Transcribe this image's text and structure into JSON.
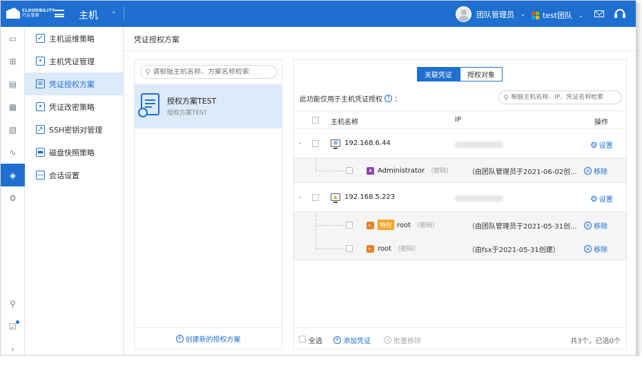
{
  "header": {
    "logo_text": "CLOUDBILITY",
    "logo_sub": "行云管家",
    "module": "主机",
    "user": "团队管理员",
    "team": "test团队",
    "colors": {
      "primary": "#1e6fd0",
      "accent": "#f5a623"
    }
  },
  "rail": [
    {
      "icon": "monitor-icon"
    },
    {
      "icon": "sitemap-icon"
    },
    {
      "icon": "document-icon"
    },
    {
      "icon": "clipboard-icon"
    },
    {
      "icon": "checklist-icon"
    },
    {
      "icon": "pulse-icon"
    },
    {
      "icon": "shield-gear-icon",
      "active": true
    },
    {
      "icon": "gear-icon"
    },
    {
      "icon": "search-icon"
    },
    {
      "icon": "task-icon"
    },
    {
      "icon": "chevron-right-icon"
    }
  ],
  "menu": {
    "items": [
      {
        "label": "主机运维策略",
        "icon": "shield-check-icon"
      },
      {
        "label": "主机凭证管理",
        "icon": "key-icon"
      },
      {
        "label": "凭证授权方案",
        "icon": "certificate-icon",
        "active": true
      },
      {
        "label": "凭证改密策略",
        "icon": "lock-icon"
      },
      {
        "label": "SSH密钥对管理",
        "icon": "key-pair-icon"
      },
      {
        "label": "磁盘快照策略",
        "icon": "disk-icon"
      },
      {
        "label": "会话设置",
        "icon": "window-icon"
      }
    ]
  },
  "page": {
    "title": "凭证授权方案"
  },
  "left_panel": {
    "search_placeholder": "请根据主机名称、方案名称检索",
    "plan": {
      "name": "授权方案TEST",
      "sub": "授权方案TEST"
    },
    "create_label": "创建新的授权方案"
  },
  "right_panel": {
    "tabs": [
      {
        "label": "关联凭证",
        "active": true
      },
      {
        "label": "授权对象"
      }
    ],
    "notice": "此功能仅用于主机凭证授权",
    "notice_suffix": "：",
    "search_placeholder": "根据主机名称、IP、凭证名称检索",
    "columns": {
      "name": "主机名称",
      "ip": "IP",
      "ops": "操作"
    },
    "hosts": [
      {
        "name": "192.168.6.44",
        "os": "windows",
        "setup_label": "设置",
        "accounts": [
          {
            "name": "Administrator",
            "type": "（密码）",
            "privileged": false,
            "creator": "（由团队管理员于2021-06-02创...",
            "remove_label": "移除"
          }
        ]
      },
      {
        "name": "192.168.5.223",
        "os": "linux",
        "setup_label": "设置",
        "accounts": [
          {
            "name": "root",
            "type": "（密码）",
            "privileged": true,
            "priv_label": "特权",
            "creator": "（由团队管理员于2021-05-31创...",
            "remove_label": "移除"
          },
          {
            "name": "root",
            "type": "（密码）",
            "privileged": false,
            "creator": "（由fsx于2021-05-31创建）",
            "remove_label": "移除"
          }
        ]
      }
    ],
    "footer": {
      "select_all": "全选",
      "add": "添加凭证",
      "batch_remove": "批量移除",
      "count": "共3个，已选0个"
    }
  }
}
